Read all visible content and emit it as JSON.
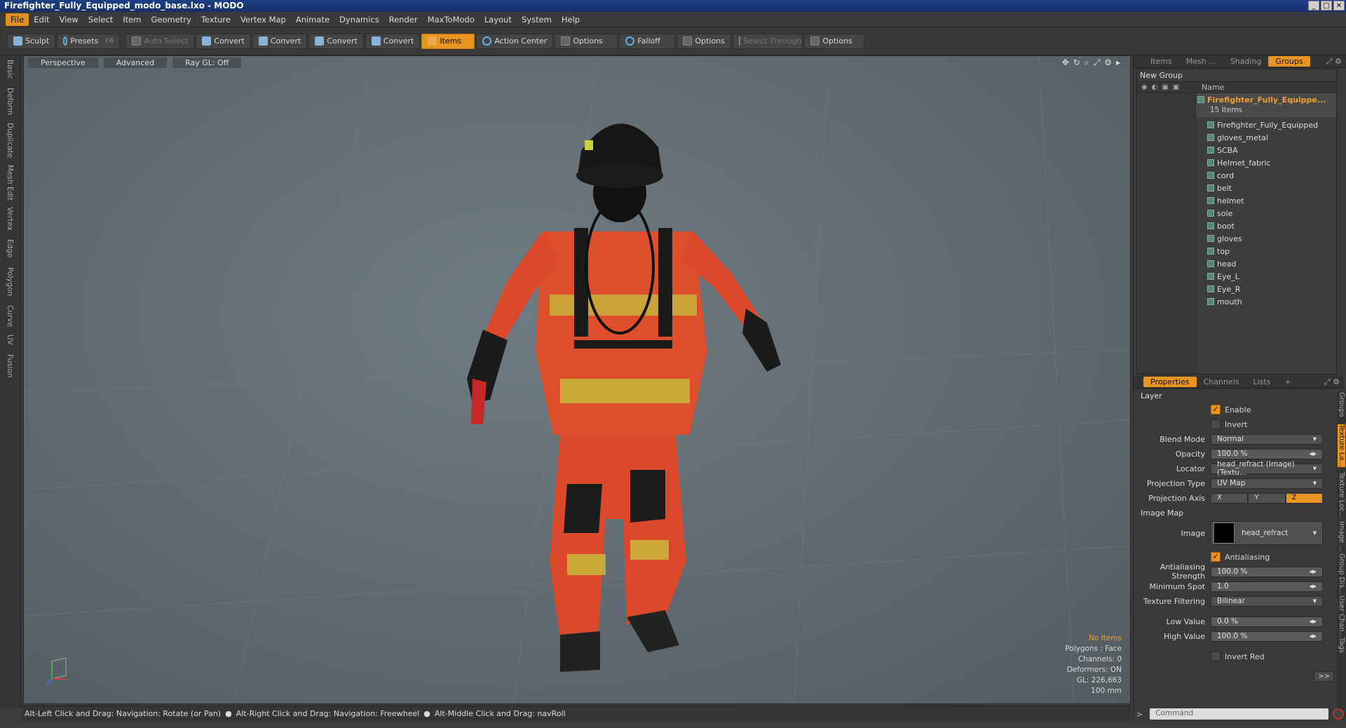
{
  "window": {
    "title": "Firefighter_Fully_Equipped_modo_base.lxo - MODO"
  },
  "menu": [
    "File",
    "Edit",
    "View",
    "Select",
    "Item",
    "Geometry",
    "Texture",
    "Vertex Map",
    "Animate",
    "Dynamics",
    "Render",
    "MaxToModo",
    "Layout",
    "System",
    "Help"
  ],
  "toolbar": {
    "sculpt": "Sculpt",
    "presets": "Presets",
    "presets_hotkey": "F6",
    "auto_select": "Auto Select",
    "convert": "Convert",
    "items": "Items",
    "action_center": "Action Center",
    "options": "Options",
    "falloff": "Falloff",
    "select_through": "Select Through"
  },
  "left_tabs": [
    "Basic",
    "Deform",
    "Duplicate",
    "Mesh Edit",
    "Vertex",
    "Edge",
    "Polygon",
    "Curve",
    "UV",
    "Fusion"
  ],
  "viewport": {
    "view": "Perspective",
    "shading": "Advanced",
    "raygl": "Ray GL: Off",
    "stats": {
      "selection": "No Items",
      "polygons": "Polygons : Face",
      "channels": "Channels: 0",
      "deformers": "Deformers: ON",
      "gl": "GL: 226,663",
      "scale": "100 mm"
    }
  },
  "status": {
    "hint1": "Alt-Left Click and Drag: Navigation: Rotate (or Pan)",
    "hint2": "Alt-Right Click and Drag: Navigation: Freewheel",
    "hint3": "Alt-Middle Click and Drag: navRoll"
  },
  "right_tabs": [
    "Items",
    "Mesh ...",
    "Shading",
    "Groups"
  ],
  "groups": {
    "new_group": "New Group",
    "col_name": "Name",
    "parent": "Firefighter_Fully_Equippe...",
    "count": "15 Items",
    "items": [
      "Firefighter_Fully_Equipped",
      "gloves_metal",
      "SCBA",
      "Helmet_fabric",
      "cord",
      "belt",
      "helmet",
      "sole",
      "boot",
      "gloves",
      "top",
      "head",
      "Eye_L",
      "Eye_R",
      "mouth"
    ]
  },
  "prop_tabs": [
    "Properties",
    "Channels",
    "Lists",
    "+"
  ],
  "properties": {
    "layer": "Layer",
    "enable": "Enable",
    "invert": "Invert",
    "blend_mode_label": "Blend Mode",
    "blend_mode": "Normal",
    "opacity_label": "Opacity",
    "opacity": "100.0 %",
    "locator_label": "Locator",
    "locator": "head_refract (Image) (Textu...",
    "projection_type_label": "Projection Type",
    "projection_type": "UV Map",
    "projection_axis_label": "Projection Axis",
    "axes": [
      "X",
      "Y",
      "Z"
    ],
    "image_map": "Image Map",
    "image_label": "Image",
    "image": "head_refract",
    "antialiasing": "Antialiasing",
    "aa_strength_label": "Antialiasing Strength",
    "aa_strength": "100.0 %",
    "min_spot_label": "Minimum Spot",
    "min_spot": "1.0",
    "tex_filter_label": "Texture Filtering",
    "tex_filter": "Bilinear",
    "low_value_label": "Low Value",
    "low_value": "0.0 %",
    "high_value_label": "High Value",
    "high_value": "100.0 %",
    "invert_red": "Invert Red"
  },
  "side_vtabs": [
    "Groups",
    "Texture La...",
    "Texture Loc...",
    "Image ...",
    "Group Dis...",
    "User Chan...",
    "Tags"
  ],
  "command": {
    "placeholder": "Command"
  },
  "colors": {
    "accent": "#e8941f",
    "titlebar": "#1e3f86"
  }
}
